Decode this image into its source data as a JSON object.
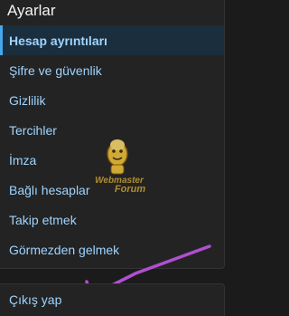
{
  "panel": {
    "title": "Ayarlar",
    "items": [
      {
        "label": "Hesap ayrıntıları",
        "active": true
      },
      {
        "label": "Şifre ve güvenlik",
        "active": false
      },
      {
        "label": "Gizlilik",
        "active": false
      },
      {
        "label": "Tercihler",
        "active": false
      },
      {
        "label": "İmza",
        "active": false
      },
      {
        "label": "Bağlı hesaplar",
        "active": false
      },
      {
        "label": "Takip etmek",
        "active": false
      },
      {
        "label": "Görmezden gelmek",
        "active": false
      }
    ]
  },
  "logout": {
    "label": "Çıkış yap"
  },
  "watermark": {
    "line1": "Webmaster",
    "line2": "Forum"
  },
  "colors": {
    "link": "#9fd4ff",
    "accent": "#47a7eb",
    "annotation": "#b04fd0"
  }
}
